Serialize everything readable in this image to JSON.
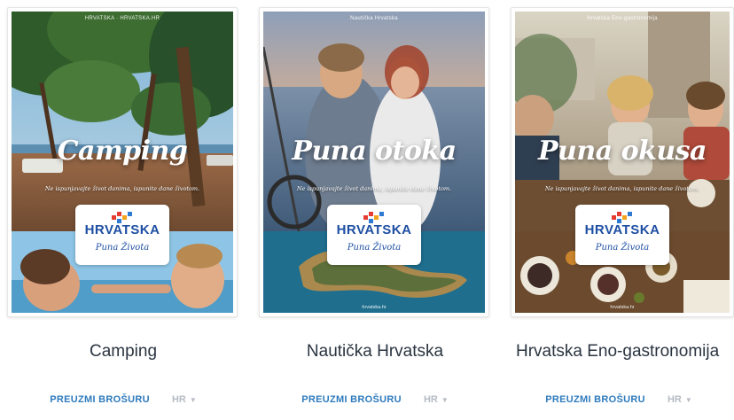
{
  "colors": {
    "link": "#2f7bbd",
    "title": "#2a3440",
    "lang": "#b6bcc4",
    "logo_blue": "#1e4fa3"
  },
  "brand": {
    "logo_text": "HRVATSKA",
    "logo_tagline": "Puna Života"
  },
  "brochures": [
    {
      "title": "Camping",
      "cover_headline": "Camping",
      "cover_subline": "Ne ispunjavajte život danima, ispunite dane životom.",
      "download_label": "PREUZMI BROŠURU",
      "language": "HR"
    },
    {
      "title": "Nautička Hrvatska",
      "cover_top_text": "Nautička Hrvatska",
      "cover_headline": "Puna otoka",
      "cover_subline": "Ne ispunjavajte život danima, ispunite dane životom.",
      "cover_footer": "hrvatska.hr",
      "download_label": "PREUZMI BROŠURU",
      "language": "HR"
    },
    {
      "title": "Hrvatska Eno-gastronomija",
      "cover_top_text": "Hrvatska Eno-gastronomija",
      "cover_headline": "Puna okusa",
      "cover_subline": "Ne ispunjavajte život danima, ispunite dane životom.",
      "cover_footer": "hrvatska.hr",
      "download_label": "PREUZMI BROŠURU",
      "language": "HR"
    }
  ]
}
